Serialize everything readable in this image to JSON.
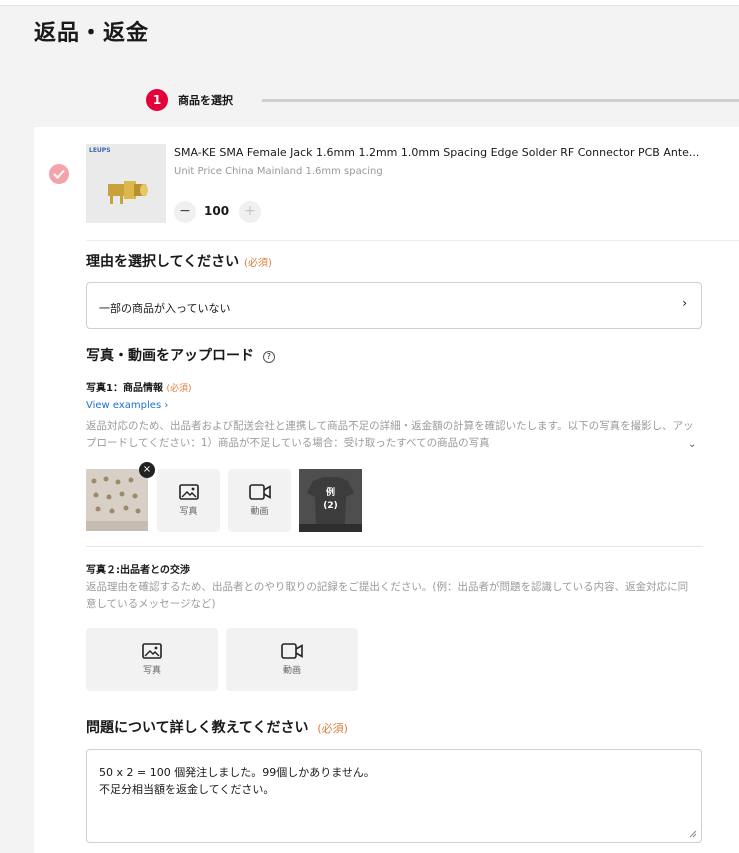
{
  "page": {
    "title": "返品・返金"
  },
  "stepper": {
    "step_number": "1",
    "step_label": "商品を選択"
  },
  "product": {
    "brand_logo_text": "LEUPS",
    "title": "SMA-KE SMA Female Jack 1.6mm 1.2mm 1.0mm Spacing Edge Solder RF Connector PCB Ante...",
    "variant": "Unit Price China Mainland 1.6mm spacing",
    "quantity": "100",
    "minus": "−",
    "plus": "+"
  },
  "reason": {
    "heading": "理由を選択してください",
    "required": "(必須)",
    "selected": "一部の商品が入っていない",
    "chevron": "›"
  },
  "upload": {
    "heading": "写真・動画をアップロード",
    "help": "?",
    "photo1": {
      "label": "写真1：商品情報",
      "required": "(必須)",
      "view_examples": "View examples ›",
      "description": "返品対応のため、出品者および配送会社と連携して商品不足の詳細・返金額の計算を確認いたします。以下の写真を撮影し、アップロードしてください：1）商品が不足している場合：受け取ったすべての商品の写真",
      "expand": "⌄",
      "remove": "×",
      "photo_tile": "写真",
      "video_tile": "動画",
      "example_label": "例",
      "example_count": "(2)"
    },
    "photo2": {
      "label": "写真２:出品者との交渉",
      "description": "返品理由を確認するため、出品者とのやり取りの記録をご提出ください。(例：出品者が問題を認識している内容、返金対応に同意しているメッセージなど)",
      "photo_tile": "写真",
      "video_tile": "動画"
    }
  },
  "details": {
    "heading": "問題について詳しく教えてください",
    "required": "(必須)",
    "line1": "50 x 2 = 100 個発注しました。99個しかありません。",
    "line2": "不足分相当額を返金してください。"
  },
  "colors": {
    "accent": "#e4003a",
    "required": "#e07b3a",
    "link": "#1f6fd1"
  }
}
